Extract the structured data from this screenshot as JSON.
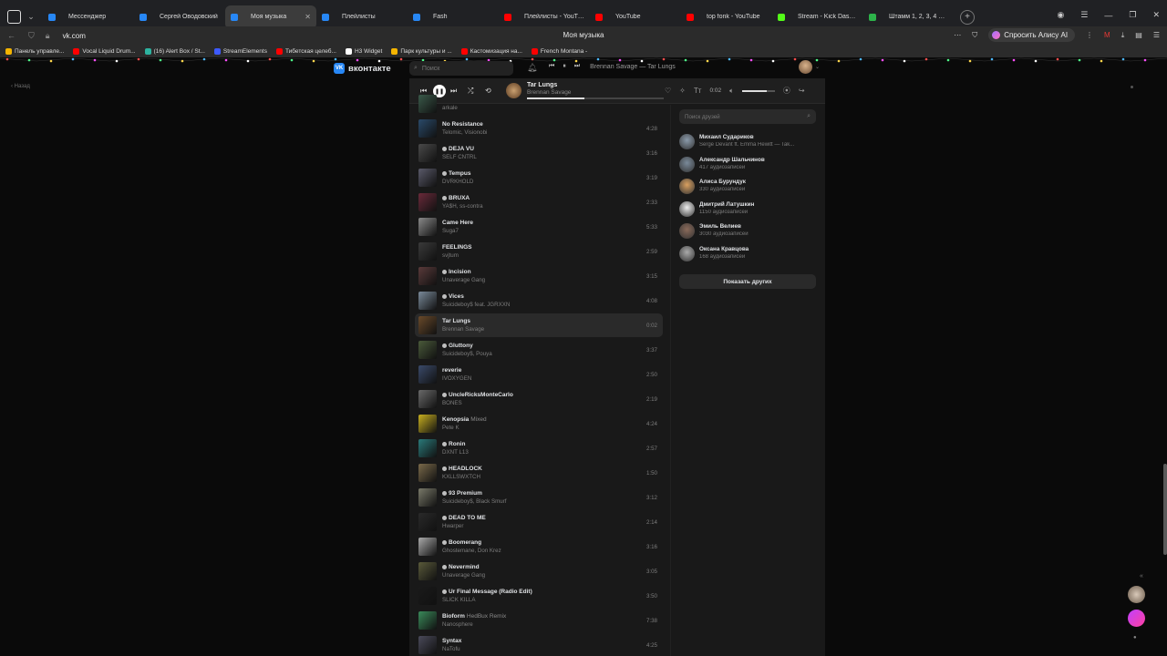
{
  "browser": {
    "tabs": [
      {
        "label": "Мессенджер",
        "color": "#2787f5",
        "active": false
      },
      {
        "label": "Сергей Оводовский",
        "color": "#2787f5",
        "active": false
      },
      {
        "label": "Моя музыка",
        "color": "#2787f5",
        "active": true
      },
      {
        "label": "Плейлисты",
        "color": "#2787f5",
        "active": false
      },
      {
        "label": "Fash",
        "color": "#2787f5",
        "active": false
      },
      {
        "label": "Плейлисты - YouTube",
        "color": "#ff0000",
        "active": false
      },
      {
        "label": "YouTube",
        "color": "#ff0000",
        "active": false
      },
      {
        "label": "top fonk - YouTube",
        "color": "#ff0000",
        "active": false
      },
      {
        "label": "Stream - Kick Dashboard",
        "color": "#53fc18",
        "active": false
      },
      {
        "label": "Штамм 1, 2, 3, 4 Сезон Сериал",
        "color": "#2db34a",
        "active": false
      }
    ],
    "url": "vk.com",
    "page_title": "Моя музыка",
    "alice_label": "Спросить Алису AI",
    "bookmarks": [
      {
        "label": "Панель управле...",
        "color": "#f4b400"
      },
      {
        "label": "Vocal Liquid Drum...",
        "color": "#ff0000"
      },
      {
        "label": "(16) Alert Box / St...",
        "color": "#2db3a0"
      },
      {
        "label": "StreamElements",
        "color": "#3d5afe"
      },
      {
        "label": "Тибетская целеб...",
        "color": "#ff0000"
      },
      {
        "label": "H3 Widget",
        "color": "#ffffff"
      },
      {
        "label": "Парк культуры и ...",
        "color": "#f4b400"
      },
      {
        "label": "Кастомизация на...",
        "color": "#ff0000"
      },
      {
        "label": "French Montana -",
        "color": "#ff0000"
      }
    ]
  },
  "vk": {
    "logo_text": "вконтакте",
    "logo_mark": "VK",
    "search_placeholder": "Поиск",
    "back_label": "Назад",
    "top_now_playing": "Brennan Savage — Tar Lungs"
  },
  "player": {
    "title": "Tar Lungs",
    "artist": "Brennan Savage",
    "time": "0:02",
    "progress": 0.42,
    "volume": 0.75
  },
  "tracks": [
    {
      "title": "",
      "subtitle": "",
      "artist": "arkale",
      "duration": "",
      "explicit": false,
      "active": false,
      "color": "#3a5a4a"
    },
    {
      "title": "No Resistance",
      "subtitle": "",
      "artist": "Telomic, Visionobi",
      "duration": "4:28",
      "explicit": false,
      "active": false,
      "color": "#2a4a6a"
    },
    {
      "title": "DEJA VU",
      "subtitle": "",
      "artist": "SELF CNTRL",
      "duration": "3:16",
      "explicit": true,
      "active": false,
      "color": "#4a4a4a"
    },
    {
      "title": "Tempus",
      "subtitle": "",
      "artist": "DVRKHOLD",
      "duration": "3:19",
      "explicit": true,
      "active": false,
      "color": "#5a5a6a"
    },
    {
      "title": "BRUXA",
      "subtitle": "",
      "artist": "YA$H, ss-contra",
      "duration": "2:33",
      "explicit": true,
      "active": false,
      "color": "#6a2a3a"
    },
    {
      "title": "Came Here",
      "subtitle": "",
      "artist": "Suga7",
      "duration": "5:33",
      "explicit": false,
      "active": false,
      "color": "#8a8a8a"
    },
    {
      "title": "FEELINGS",
      "subtitle": "",
      "artist": "svjtum",
      "duration": "2:59",
      "explicit": false,
      "active": false,
      "color": "#3a3a3a"
    },
    {
      "title": "Incision",
      "subtitle": "",
      "artist": "Unaverage Gang",
      "duration": "3:15",
      "explicit": true,
      "active": false,
      "color": "#5a3a3a"
    },
    {
      "title": "Vices",
      "subtitle": "",
      "artist": "Suicideboy$ feat. JGRXXN",
      "duration": "4:08",
      "explicit": true,
      "active": false,
      "color": "#7a8a9a"
    },
    {
      "title": "Tar Lungs",
      "subtitle": "",
      "artist": "Brennan Savage",
      "duration": "0:02",
      "explicit": false,
      "active": true,
      "color": "#6a4a2a"
    },
    {
      "title": "Gluttony",
      "subtitle": "",
      "artist": "Suicideboy$, Pouya",
      "duration": "3:37",
      "explicit": true,
      "active": false,
      "color": "#4a5a3a"
    },
    {
      "title": "reverie",
      "subtitle": "",
      "artist": "IVOXYGEN",
      "duration": "2:50",
      "explicit": false,
      "active": false,
      "color": "#3a4a6a"
    },
    {
      "title": "UncleRicksMonteCarlo",
      "subtitle": "",
      "artist": "BONES",
      "duration": "2:19",
      "explicit": true,
      "active": false,
      "color": "#6a6a6a"
    },
    {
      "title": "Kenopsia",
      "subtitle": "Mixed",
      "artist": "Pete K",
      "duration": "4:24",
      "explicit": false,
      "active": false,
      "color": "#c8b020"
    },
    {
      "title": "Ronin",
      "subtitle": "",
      "artist": "DXNT L13",
      "duration": "2:57",
      "explicit": true,
      "active": false,
      "color": "#2a7a7a"
    },
    {
      "title": "HEADLOCK",
      "subtitle": "",
      "artist": "KXLLSWXTCH",
      "duration": "1:50",
      "explicit": true,
      "active": false,
      "color": "#7a6a4a"
    },
    {
      "title": "93 Premium",
      "subtitle": "",
      "artist": "Suicideboy$, Black Smurf",
      "duration": "3:12",
      "explicit": true,
      "active": false,
      "color": "#7a7a6a"
    },
    {
      "title": "DEAD TO ME",
      "subtitle": "",
      "artist": "Hwarper",
      "duration": "2:14",
      "explicit": true,
      "active": false,
      "color": "#2a2a2a"
    },
    {
      "title": "Boomerang",
      "subtitle": "",
      "artist": "Ghostemane, Don Krez",
      "duration": "3:16",
      "explicit": true,
      "active": false,
      "color": "#aaaaaa"
    },
    {
      "title": "Nevermind",
      "subtitle": "",
      "artist": "Unaverage Gang",
      "duration": "3:05",
      "explicit": true,
      "active": false,
      "color": "#5a5a3a"
    },
    {
      "title": "Ur Final Message (Radio Edit)",
      "subtitle": "",
      "artist": "SLICK KILLA",
      "duration": "3:50",
      "explicit": true,
      "active": false,
      "color": "#1a1a1a"
    },
    {
      "title": "Bioform",
      "subtitle": "HedBux Remix",
      "artist": "Nanosphere",
      "duration": "7:38",
      "explicit": false,
      "active": false,
      "color": "#3a8a5a"
    },
    {
      "title": "Syntax",
      "subtitle": "",
      "artist": "NaTofu",
      "duration": "4:25",
      "explicit": false,
      "active": false,
      "color": "#4a4a5a"
    }
  ],
  "friends_panel": {
    "search_placeholder": "Поиск друзей",
    "show_more_label": "Показать других",
    "friends": [
      {
        "name": "Михаил Судариков",
        "sub": "Serge Devant ft. Emma Hewitt — Tak...",
        "color": "#8a9aaa"
      },
      {
        "name": "Александр Шальчинов",
        "sub": "417 аудиозаписей",
        "color": "#7a8a9a"
      },
      {
        "name": "Алиса Бурундук",
        "sub": "330 аудиозаписей",
        "color": "#d9a060"
      },
      {
        "name": "Дмитрий Латушкин",
        "sub": "1150 аудиозаписей",
        "color": "#eeeeee"
      },
      {
        "name": "Эмиль Велиев",
        "sub": "3030 аудиозаписей",
        "color": "#8a6a5a"
      },
      {
        "name": "Оксана Кравцова",
        "sub": "168 аудиозаписей",
        "color": "#aaaaaa"
      }
    ]
  }
}
